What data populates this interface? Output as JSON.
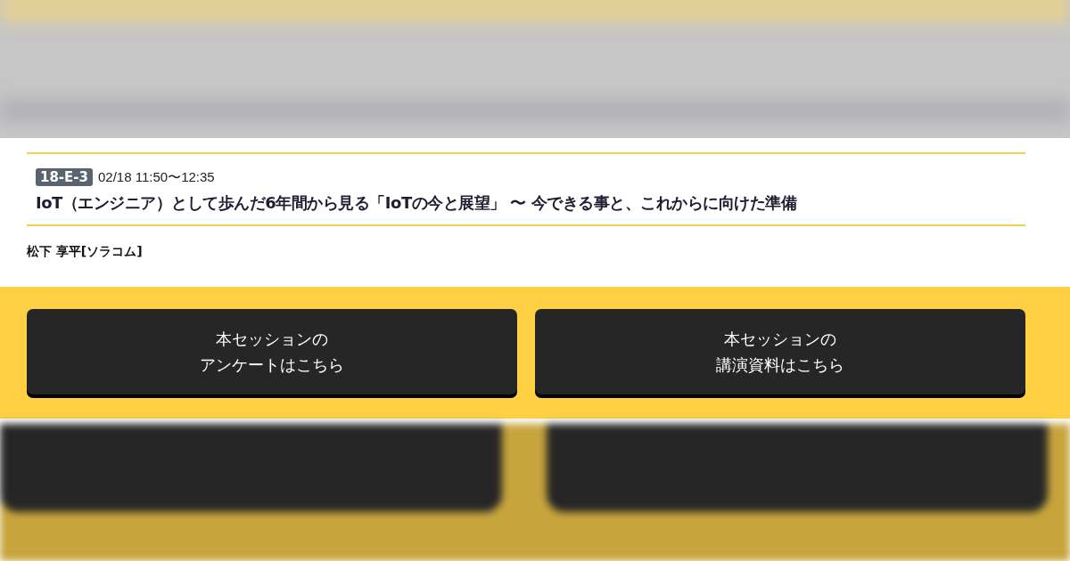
{
  "session": {
    "code": "18-E-3",
    "time": "02/18 11:50〜12:35",
    "title": "IoT（エンジニア）として歩んだ6年間から見る「IoTの今と展望」 〜 今できる事と、これからに向けた準備",
    "speaker": "松下 享平[ソラコム]"
  },
  "buttons": [
    {
      "lines": [
        "本セッションの",
        "アンケートはこちら"
      ]
    },
    {
      "lines": [
        "本セッションの",
        "講演資料はこちら"
      ]
    }
  ]
}
